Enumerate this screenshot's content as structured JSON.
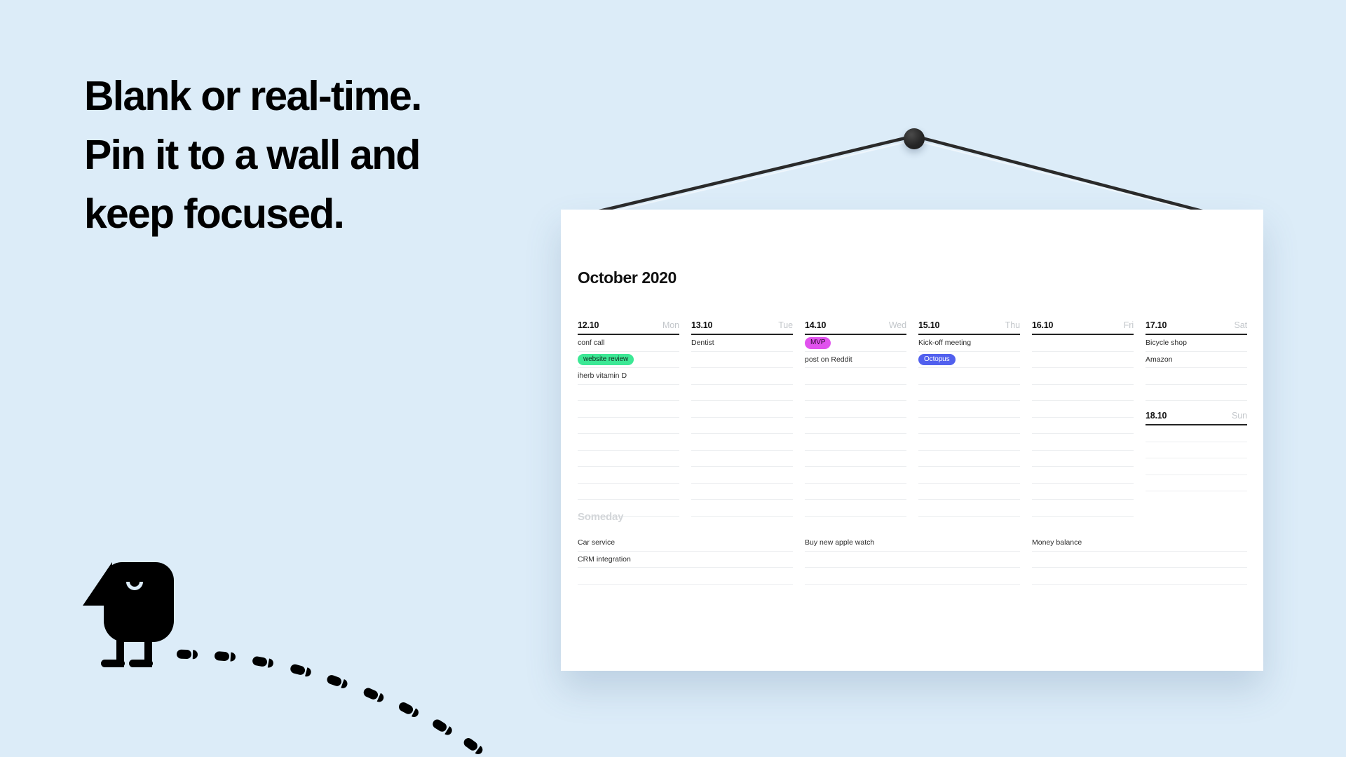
{
  "page": {
    "background_color": "#dcecf8",
    "headline_lines": [
      "Blank or real-time.",
      "Pin it to a wall and",
      "keep focused."
    ]
  },
  "calendar": {
    "title": "October 2020",
    "days": [
      {
        "date": "12.10",
        "weekday": "Mon",
        "tasks": [
          {
            "text": "conf call",
            "style": "plain"
          },
          {
            "text": "website review",
            "style": "pill-green"
          },
          {
            "text": "iherb vitamin D",
            "style": "plain"
          }
        ]
      },
      {
        "date": "13.10",
        "weekday": "Tue",
        "tasks": [
          {
            "text": "Dentist",
            "style": "plain"
          }
        ]
      },
      {
        "date": "14.10",
        "weekday": "Wed",
        "tasks": [
          {
            "text": "MVP",
            "style": "pill-magenta"
          },
          {
            "text": "post on Reddit",
            "style": "plain"
          }
        ]
      },
      {
        "date": "15.10",
        "weekday": "Thu",
        "tasks": [
          {
            "text": "Kick-off meeting",
            "style": "plain"
          },
          {
            "text": "Octopus",
            "style": "pill-blue"
          }
        ]
      },
      {
        "date": "16.10",
        "weekday": "Fri",
        "tasks": []
      },
      {
        "date": "17.10",
        "weekday": "Sat",
        "tasks": [
          {
            "text": "Bicycle shop",
            "style": "plain"
          },
          {
            "text": "Amazon",
            "style": "plain"
          }
        ],
        "second_day": {
          "date": "18.10",
          "weekday": "Sun",
          "tasks": []
        }
      }
    ],
    "someday": {
      "title": "Someday",
      "columns": [
        {
          "tasks": [
            "Car service",
            "CRM integration"
          ]
        },
        {
          "tasks": [
            "Buy new apple watch"
          ]
        },
        {
          "tasks": [
            "Money balance"
          ]
        }
      ]
    }
  },
  "decor": {
    "pin": "pin-icon",
    "bird": "bird-mascot-icon",
    "footprints": "footprint-trail-icon"
  },
  "colors": {
    "pill_green": "#3ce895",
    "pill_magenta": "#e152ee",
    "pill_blue": "#5160ee",
    "card": "#ffffff",
    "text": "#111111",
    "muted": "#c3c7cb"
  }
}
